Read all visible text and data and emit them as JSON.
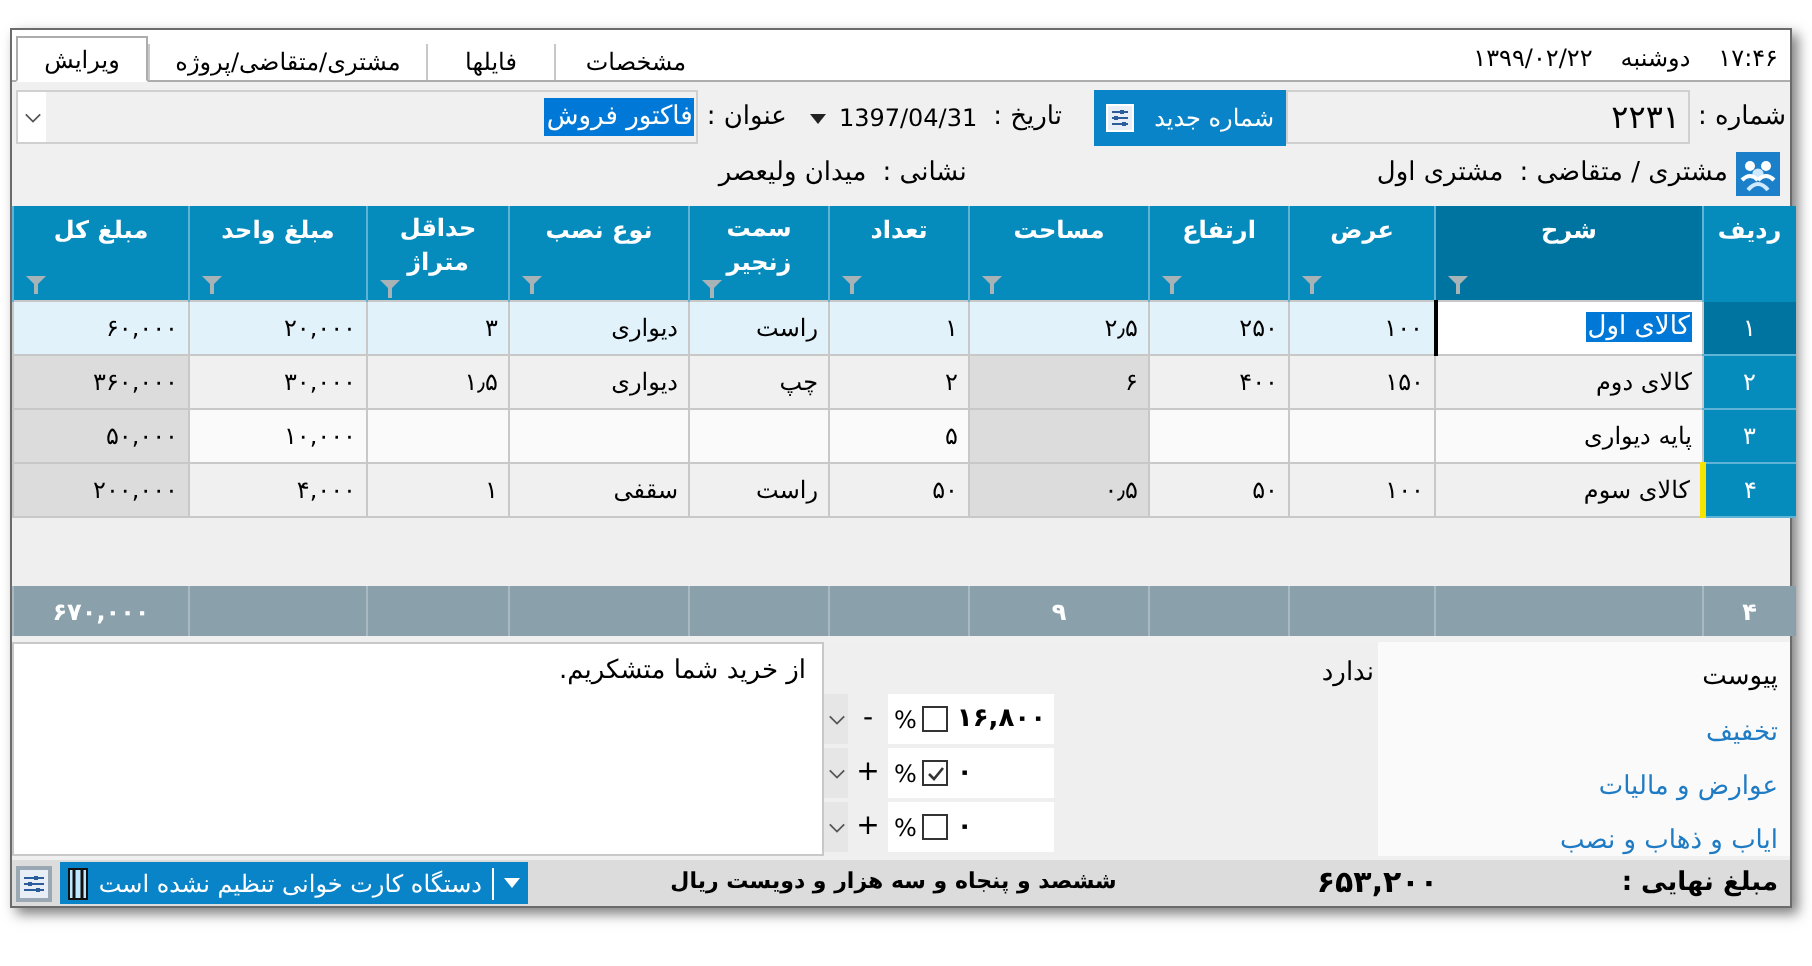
{
  "header": {
    "clock": "۱۷:۴۶",
    "weekday": "دوشنبه",
    "date": "۱۳۹۹/۰۲/۲۲"
  },
  "tabs": [
    {
      "label": "مشخصات",
      "selected": false
    },
    {
      "label": "فایلها",
      "selected": false
    },
    {
      "label": "مشتری/متقاضی/پروژه",
      "selected": false
    },
    {
      "label": "ویرایش",
      "selected": true
    }
  ],
  "form": {
    "number_label": "شماره :",
    "number_value": "۲۲۳۱",
    "new_number_button": "شماره جدید",
    "date_label": "تاریخ :",
    "date_value": "1397/04/31",
    "title_label": "عنوان :",
    "title_value": "فاکتور فروش",
    "customer_label": "مشتری / متقاضی :",
    "customer_value": "مشتری اول",
    "address_label": "نشانی :",
    "address_value": "میدان ولیعصر"
  },
  "table": {
    "columns": [
      {
        "label": "ردیف",
        "filter": false,
        "active": false,
        "wrap": false,
        "total": "۴"
      },
      {
        "label": "شرح",
        "filter": true,
        "active": true,
        "wrap": false
      },
      {
        "label": "عرض",
        "filter": true,
        "active": false,
        "wrap": false
      },
      {
        "label": "ارتفاع",
        "filter": true,
        "active": false,
        "wrap": false
      },
      {
        "label": "مساحت",
        "filter": true,
        "active": false,
        "wrap": false,
        "readonly": true,
        "total": "۹"
      },
      {
        "label": "تعداد",
        "filter": true,
        "active": false,
        "wrap": false
      },
      {
        "label": "سمت زنجیر",
        "filter": true,
        "active": false,
        "wrap": true
      },
      {
        "label": "نوع نصب",
        "filter": true,
        "active": false,
        "wrap": false
      },
      {
        "label": "حداقل متراژ",
        "filter": true,
        "active": false,
        "wrap": true
      },
      {
        "label": "مبلغ واحد",
        "filter": true,
        "active": false,
        "wrap": false
      },
      {
        "label": "مبلغ کل",
        "filter": true,
        "active": false,
        "wrap": false,
        "readonly": true,
        "total": "۶۷۰,۰۰۰"
      }
    ],
    "rows": [
      {
        "selected": true,
        "editing": true,
        "flagged": false,
        "cells": [
          "۱",
          "کالای اول",
          "۱۰۰",
          "۲۵۰",
          "۲٫۵",
          "۱",
          "راست",
          "دیواری",
          "۳",
          "۲۰,۰۰۰",
          "۶۰,۰۰۰"
        ]
      },
      {
        "selected": false,
        "editing": false,
        "flagged": false,
        "cells": [
          "۲",
          "کالای دوم",
          "۱۵۰",
          "۴۰۰",
          "۶",
          "۲",
          "چپ",
          "دیواری",
          "۱٫۵",
          "۳۰,۰۰۰",
          "۳۶۰,۰۰۰"
        ]
      },
      {
        "selected": false,
        "editing": false,
        "flagged": false,
        "cells": [
          "۳",
          "پایه دیواری",
          null,
          null,
          null,
          "۵",
          null,
          null,
          null,
          "۱۰,۰۰۰",
          "۵۰,۰۰۰"
        ]
      },
      {
        "selected": false,
        "editing": false,
        "flagged": true,
        "cells": [
          "۴",
          "کالای سوم",
          "۱۰۰",
          "۵۰",
          "۰٫۵",
          "۵۰",
          "راست",
          "سقفی",
          "۱",
          "۴,۰۰۰",
          "۲۰۰,۰۰۰"
        ]
      }
    ]
  },
  "attachment": {
    "label": "پیوست",
    "value": "ندارد"
  },
  "adjustments": [
    {
      "label": "تخفیف",
      "amount": "۱۶,۸۰۰",
      "percent_checked": false,
      "percent": "%",
      "sign": "-"
    },
    {
      "label": "عوارض و مالیات",
      "amount": "۰",
      "percent_checked": true,
      "percent": "%",
      "sign": "+"
    },
    {
      "label": "ایاب و ذهاب و نصب",
      "amount": "۰",
      "percent_checked": false,
      "percent": "%",
      "sign": "+"
    }
  ],
  "note": "از خرید شما متشکریم.",
  "status_bar": {
    "total_label": "مبلغ نهایی :",
    "total": "۶۵۳,۲۰۰",
    "total_words": "ششصد و پنجاه و سه هزار و دویست ریال",
    "card_reader": "دستگاه کارت خوانی تنظیم نشده است"
  }
}
